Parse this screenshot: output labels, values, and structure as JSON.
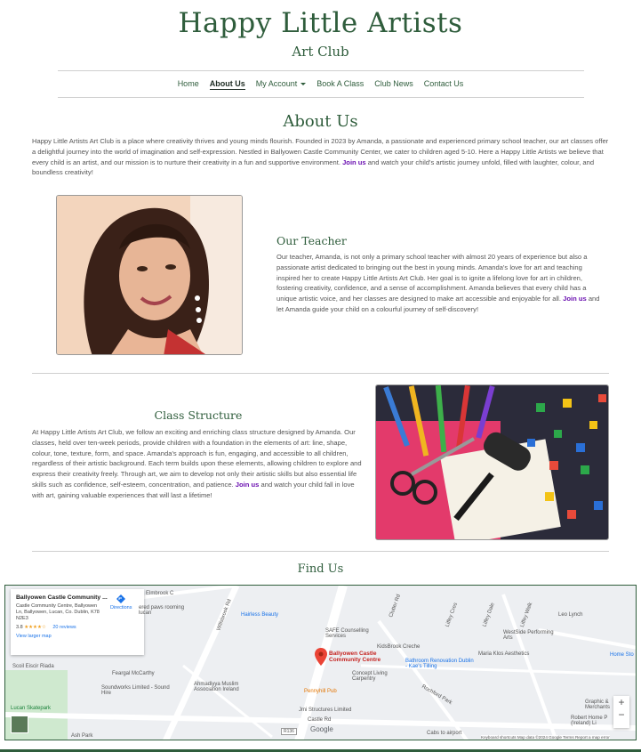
{
  "header": {
    "brand": "Happy Little Artists",
    "subtitle": "Art Club"
  },
  "nav": {
    "home": "Home",
    "about": "About Us",
    "account": "My Account",
    "book": "Book A Class",
    "news": "Club News",
    "contact": "Contact Us"
  },
  "about": {
    "title": "About Us",
    "text1": "Happy Little Artists Art Club is a place where creativity thrives and young minds flourish. Founded in 2023 by Amanda, a passionate and experienced primary school teacher, our art classes offer a delightful journey into the world of imagination and self-expression. Nestled in Ballyowen Castle Community Center, we cater to children aged 5-10. Here a Happy Little Artists we believe that every child is an artist, and our mission is to nurture their creativity in a fun and supportive environment.",
    "join": "Join us",
    "text2": "and watch your child's artistic journey unfold, filled with laughter, colour, and boundless creativity!"
  },
  "teacher": {
    "title": "Our Teacher",
    "text1": "Our teacher, Amanda, is not only a primary school teacher with almost 20 years of experience but also a passionate artist dedicated to bringing out the best in young minds. Amanda's love for art and teaching inspired her to create Happy Little Artists Art Club. Her goal is to ignite a lifelong love for art in children, fostering creativity, confidence, and a sense of accomplishment. Amanda believes that every child has a unique artistic voice, and her classes are designed to make art accessible and enjoyable for all.",
    "join": "Join us",
    "text2": "and let Amanda guide your child on a colourful journey of self-discovery!"
  },
  "structure": {
    "title": "Class Structure",
    "text1": "At Happy Little Artists Art Club, we follow an exciting and enriching class structure designed by Amanda. Our classes, held over ten-week periods, provide children with a foundation in the elements of art: line, shape, colour, tone, texture, form, and space. Amanda's approach is fun, engaging, and accessible to all children, regardless of their artistic background. Each term builds upon these elements, allowing children to explore and express their creativity freely. Through art, we aim to develop not only their artistic skills but also essential life skills such as confidence, self-esteem, concentration, and patience.",
    "join": "Join us",
    "text2": "and watch your child fall in love with art, gaining valuable experiences that will last a lifetime!"
  },
  "find": {
    "title": "Find Us"
  },
  "map": {
    "card_title": "Ballyowen Castle Community ...",
    "card_address": "Castle Community Centre, Ballyowen Ln, Ballyowen, Lucan, Co. Dublin, K78 N2E3",
    "rating": "3.8",
    "stars": "★★★★☆",
    "reviews": "20 reviews",
    "directions": "Directions",
    "larger": "View larger map",
    "pin_label": "Ballyowen Castle Community Centre",
    "labels": [
      "Elmbrook C",
      "Willsbrook Rd",
      "ered paws rooming lucan",
      "Hairless Beauty",
      "SAFE Counselling Services",
      "Clutter Rd",
      "Liffey Cres",
      "Liffey Dale",
      "Liffey Walk",
      "Leo Lynch",
      "WestSide Performing Arts",
      "KidsBrook Creche",
      "Maria Klos Aesthetics",
      "Home Sto",
      "Bathroom Renovation Dublin - Kae's Tilling",
      "Concept Living Carpentry",
      "Pennyhill Pub",
      "Feargal McCarthy",
      "Soundworks Limited - Sound Hire",
      "Ahmadiyya Muslim Association Ireland",
      "Scoil Eiscir Riada",
      "Lucan Skatepark",
      "Castle Rd",
      "Jmi Structures Limited",
      "Cabs to airport",
      "Graphic & Merchants",
      "Robert Home P (Ireland) Li",
      "Rochford Park",
      "Ash Park"
    ],
    "google": "Google",
    "footer": "Keyboard shortcuts   Map data ©2024 Google   Terms   Report a map error",
    "road_r136": "R136",
    "zoom_in": "+",
    "zoom_out": "−"
  }
}
